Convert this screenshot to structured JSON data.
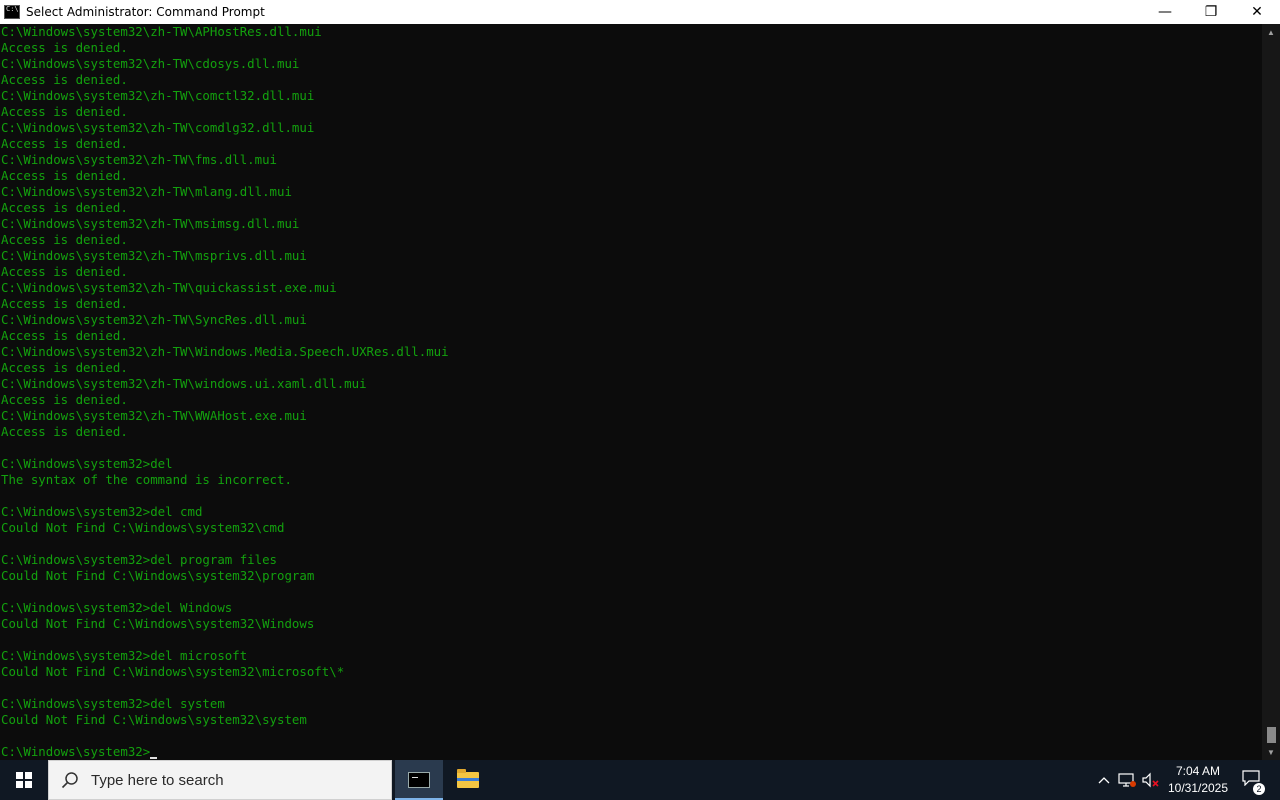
{
  "window": {
    "title": "Select Administrator: Command Prompt",
    "controls": {
      "minimize": "—",
      "restore": "❐",
      "close": "✕"
    }
  },
  "console": {
    "text_color": "#13a10e",
    "background": "#0c0c0c",
    "lines": [
      "C:\\Windows\\system32\\zh-TW\\APHostRes.dll.mui",
      "Access is denied.",
      "C:\\Windows\\system32\\zh-TW\\cdosys.dll.mui",
      "Access is denied.",
      "C:\\Windows\\system32\\zh-TW\\comctl32.dll.mui",
      "Access is denied.",
      "C:\\Windows\\system32\\zh-TW\\comdlg32.dll.mui",
      "Access is denied.",
      "C:\\Windows\\system32\\zh-TW\\fms.dll.mui",
      "Access is denied.",
      "C:\\Windows\\system32\\zh-TW\\mlang.dll.mui",
      "Access is denied.",
      "C:\\Windows\\system32\\zh-TW\\msimsg.dll.mui",
      "Access is denied.",
      "C:\\Windows\\system32\\zh-TW\\msprivs.dll.mui",
      "Access is denied.",
      "C:\\Windows\\system32\\zh-TW\\quickassist.exe.mui",
      "Access is denied.",
      "C:\\Windows\\system32\\zh-TW\\SyncRes.dll.mui",
      "Access is denied.",
      "C:\\Windows\\system32\\zh-TW\\Windows.Media.Speech.UXRes.dll.mui",
      "Access is denied.",
      "C:\\Windows\\system32\\zh-TW\\windows.ui.xaml.dll.mui",
      "Access is denied.",
      "C:\\Windows\\system32\\zh-TW\\WWAHost.exe.mui",
      "Access is denied.",
      "",
      "C:\\Windows\\system32>del",
      "The syntax of the command is incorrect.",
      "",
      "C:\\Windows\\system32>del cmd",
      "Could Not Find C:\\Windows\\system32\\cmd",
      "",
      "C:\\Windows\\system32>del program files",
      "Could Not Find C:\\Windows\\system32\\program",
      "",
      "C:\\Windows\\system32>del Windows",
      "Could Not Find C:\\Windows\\system32\\Windows",
      "",
      "C:\\Windows\\system32>del microsoft",
      "Could Not Find C:\\Windows\\system32\\microsoft\\*",
      "",
      "C:\\Windows\\system32>del system",
      "Could Not Find C:\\Windows\\system32\\system",
      ""
    ],
    "prompt": "C:\\Windows\\system32>"
  },
  "taskbar": {
    "search_placeholder": "Type here to search",
    "clock_time": "7:04 AM",
    "clock_date": "10/31/2025",
    "notification_count": "2",
    "background": "#101823"
  }
}
